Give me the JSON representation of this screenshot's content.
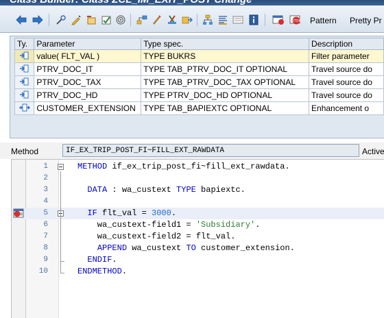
{
  "window": {
    "title": "Class Builder: Class ZCL_IM_EXIT_POST Change"
  },
  "toolbar": {
    "icons": [
      "back-arrow-icon",
      "forward-arrow-icon",
      "other-object-icon",
      "display-change-icon",
      "activate-icon",
      "check-icon",
      "where-used-icon",
      "object-list-icon",
      "pretty-edit-icon",
      "transport-icon",
      "navigation-window-icon",
      "hierarchy-icon",
      "signature-icon",
      "class-info-icon",
      "help-icon",
      "breakpoint-set-icon",
      "breakpoint-stop-icon"
    ],
    "pattern_label": "Pattern",
    "pretty_printer_label": "Pretty Pr"
  },
  "params": {
    "columns": [
      "Ty.",
      "Parameter",
      "Type spec.",
      "Description"
    ],
    "rows": [
      {
        "type_icon": "importing-param-icon",
        "parameter": "value( FLT_VAL )",
        "type_spec": "TYPE BUKRS",
        "description": "Filter parameter"
      },
      {
        "type_icon": "importing-param-icon",
        "parameter": "PTRV_DOC_IT",
        "type_spec": "TYPE TAB_PTRV_DOC_IT OPTIONAL",
        "description": "Travel source do"
      },
      {
        "type_icon": "importing-param-icon",
        "parameter": "PTRV_DOC_TAX",
        "type_spec": "TYPE TAB_PTRV_DOC_TAX OPTIONAL",
        "description": "Travel source do"
      },
      {
        "type_icon": "importing-param-icon",
        "parameter": "PTRV_DOC_HD",
        "type_spec": "TYPE PTRV_DOC_HD OPTIONAL",
        "description": "Travel source do"
      },
      {
        "type_icon": "changing-param-icon",
        "parameter": "CUSTOMER_EXTENSION",
        "type_spec": "TYPE TAB_BAPIEXTC OPTIONAL",
        "description": "Enhancement o"
      }
    ]
  },
  "method": {
    "label": "Method",
    "value": "IF_EX_TRIP_POST_FI~FILL_EXT_RAWDATA",
    "status": "Active"
  },
  "code": {
    "lines": [
      {
        "n": "1",
        "text": "METHOD if_ex_trip_post_fi~fill_ext_rawdata."
      },
      {
        "n": "2",
        "text": ""
      },
      {
        "n": "3",
        "text": "  DATA : wa_custext TYPE bapiextc."
      },
      {
        "n": "4",
        "text": ""
      },
      {
        "n": "5",
        "text": "  IF flt_val = 3000."
      },
      {
        "n": "6",
        "text": "    wa_custext-field1 = 'Subsidiary'."
      },
      {
        "n": "7",
        "text": "    wa_custext-field2 = flt_val."
      },
      {
        "n": "8",
        "text": "    APPEND wa_custext TO customer_extension."
      },
      {
        "n": "9",
        "text": "  ENDIF."
      },
      {
        "n": "10",
        "text": "ENDMETHOD."
      }
    ],
    "current_line": "5",
    "breakpoint_line": "5"
  },
  "colors": {
    "keyword": "#0000c8",
    "number": "#1e6bd6",
    "string": "#2e7d32",
    "line_number": "#4f6f9f",
    "current_line_bg": "#e9eef8"
  }
}
